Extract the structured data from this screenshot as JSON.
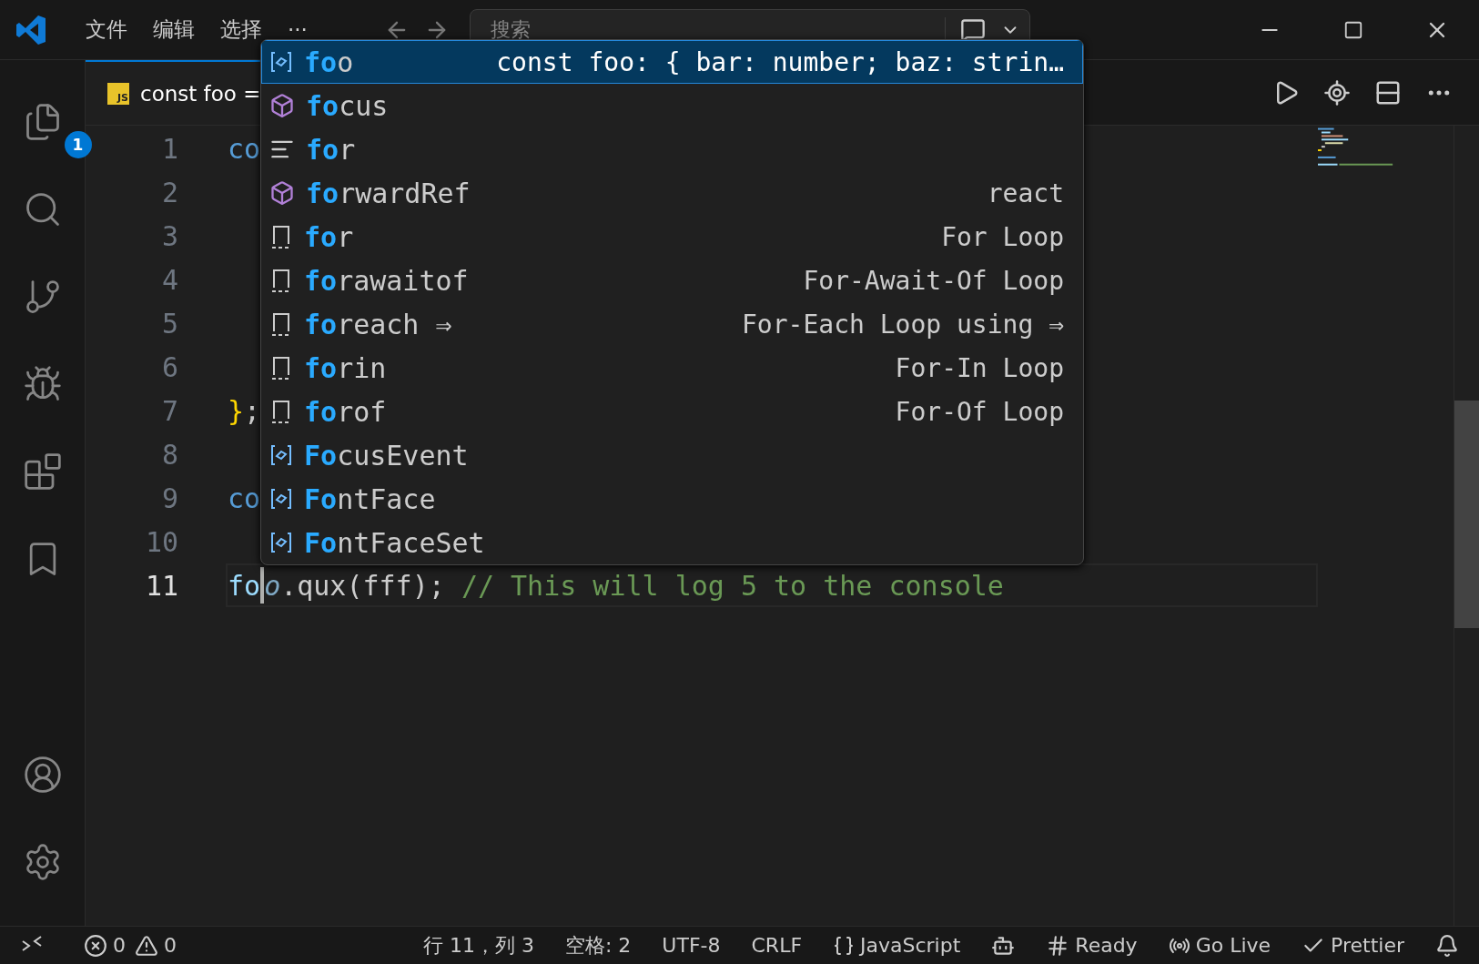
{
  "title_bar": {
    "menu": [
      "文件",
      "编辑",
      "选择",
      "···"
    ],
    "search": {
      "placeholder": "搜索"
    }
  },
  "activity_bar": {
    "top": [
      {
        "kind": "explorer",
        "badge": "1"
      },
      {
        "kind": "search"
      },
      {
        "kind": "source-control"
      },
      {
        "kind": "run-debug"
      },
      {
        "kind": "extensions"
      },
      {
        "kind": "bookmarks"
      }
    ],
    "bottom": [
      {
        "kind": "account"
      },
      {
        "kind": "settings"
      }
    ]
  },
  "tab": {
    "icon_text": "JS",
    "label": "const foo ="
  },
  "editor": {
    "lines": [
      {
        "number": "1",
        "active": false,
        "tokens": [
          {
            "text": "co",
            "kind": "keyword"
          }
        ]
      },
      {
        "number": "2",
        "active": false
      },
      {
        "number": "3",
        "active": false
      },
      {
        "number": "4",
        "active": false
      },
      {
        "number": "5",
        "active": false
      },
      {
        "number": "6",
        "active": false
      },
      {
        "number": "7",
        "active": false,
        "tokens": [
          {
            "text": "}",
            "kind": "bracket"
          },
          {
            "text": ";",
            "kind": "plain"
          }
        ]
      },
      {
        "number": "8",
        "active": false
      },
      {
        "number": "9",
        "active": false,
        "tokens": [
          {
            "text": "co",
            "kind": "keyword"
          }
        ]
      },
      {
        "number": "10",
        "active": false
      },
      {
        "number": "11",
        "active": true,
        "tokens": [
          {
            "text": "fo",
            "kind": "variable",
            "caret": true
          },
          {
            "text": "o",
            "kind": "ghost"
          },
          {
            "text": ".qux(fff); ",
            "kind": "plain"
          },
          {
            "text": "// This will log 5 to the console",
            "kind": "comment"
          }
        ]
      }
    ]
  },
  "suggestions": [
    {
      "label": "**fo**o",
      "kind": "variable",
      "detail": "const foo: { bar: number; baz: strin…",
      "selected": true
    },
    {
      "label": "**fo**cus",
      "kind": "module",
      "selected": false
    },
    {
      "label": "**fo**r",
      "kind": "keyword",
      "selected": false
    },
    {
      "label": "**fo**rwardRef",
      "kind": "module",
      "detail": "react",
      "selected": false
    },
    {
      "label": "**fo**r",
      "kind": "snippet",
      "detail": "For Loop",
      "selected": false
    },
    {
      "label": "**fo**rawaitof",
      "kind": "snippet",
      "detail": "For-Await-Of Loop",
      "selected": false
    },
    {
      "label": "**fo**reach ⇒",
      "kind": "snippet",
      "detail": "For-Each Loop using ⇒",
      "selected": false
    },
    {
      "label": "**fo**rin",
      "kind": "snippet",
      "detail": "For-In Loop",
      "selected": false
    },
    {
      "label": "**fo**rof",
      "kind": "snippet",
      "detail": "For-Of Loop",
      "selected": false
    },
    {
      "label": "**Fo**cusEvent",
      "kind": "variable",
      "selected": false
    },
    {
      "label": "**Fo**ntFace",
      "kind": "variable",
      "selected": false
    },
    {
      "label": "**Fo**ntFaceSet",
      "kind": "variable",
      "selected": false
    }
  ],
  "status_bar": {
    "errors": "0",
    "warnings": "0",
    "items": [
      {
        "kind": "text",
        "text": "行 11，列 3"
      },
      {
        "kind": "text",
        "text": "空格: 2"
      },
      {
        "kind": "text",
        "text": "UTF-8"
      },
      {
        "kind": "text",
        "text": "CRLF"
      },
      {
        "kind": "language",
        "text": "JavaScript"
      },
      {
        "kind": "copilot"
      },
      {
        "kind": "hash",
        "text": "Ready"
      },
      {
        "kind": "live",
        "text": "Go Live"
      },
      {
        "kind": "check",
        "text": "Prettier"
      },
      {
        "kind": "bell"
      }
    ]
  }
}
